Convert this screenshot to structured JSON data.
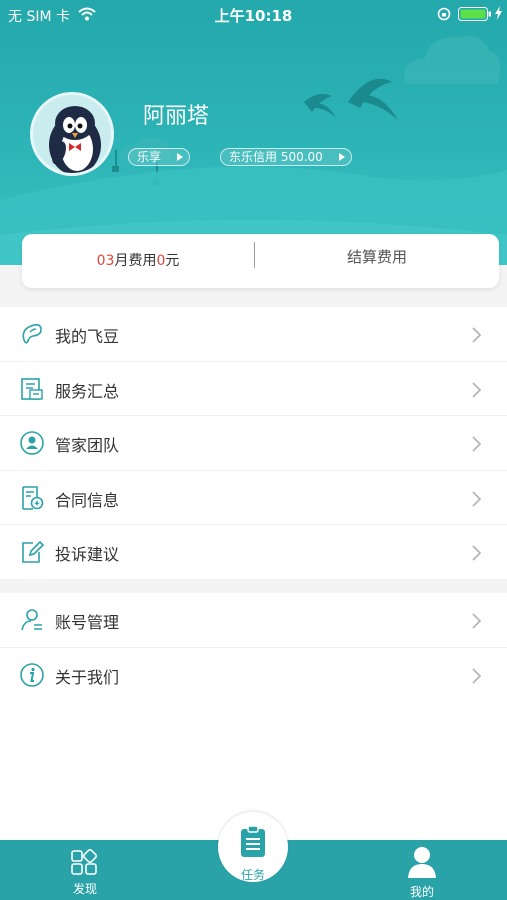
{
  "status_bar": {
    "carrier": "无 SIM 卡",
    "time": "上午10:18"
  },
  "profile": {
    "name": "阿丽塔",
    "tag_lexiang": "乐享",
    "tag_credit": "东乐信用 500.00"
  },
  "fee_card": {
    "month": "03",
    "month_suffix": "月费用",
    "amount": "0",
    "amount_suffix": "元",
    "settle_label": "结算费用"
  },
  "menu_group_1": [
    {
      "label": "我的飞豆",
      "icon": "bean-icon"
    },
    {
      "label": "服务汇总",
      "icon": "service-summary-icon"
    },
    {
      "label": "管家团队",
      "icon": "team-icon"
    },
    {
      "label": "合同信息",
      "icon": "contract-icon"
    },
    {
      "label": "投诉建议",
      "icon": "edit-icon"
    }
  ],
  "menu_group_2": [
    {
      "label": "账号管理",
      "icon": "account-icon"
    },
    {
      "label": "关于我们",
      "icon": "info-icon"
    }
  ],
  "tabbar": {
    "discover": "发现",
    "task": "任务",
    "mine": "我的",
    "active": "mine"
  },
  "colors": {
    "brand": "#2aa3a8",
    "accent_red": "#e2443a"
  }
}
